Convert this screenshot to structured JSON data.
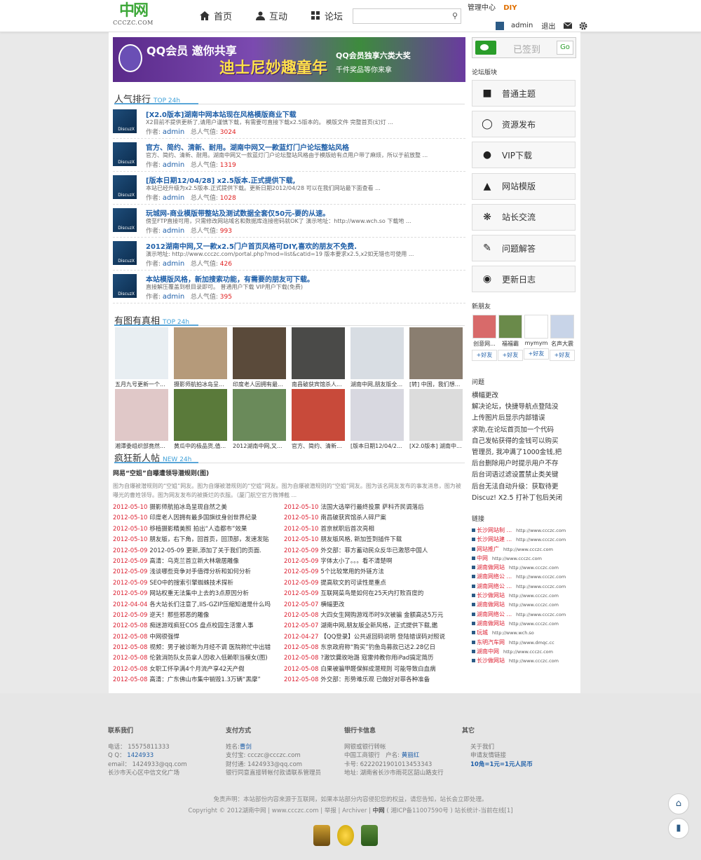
{
  "header": {
    "logo_mark": "中网",
    "logo_domain": "CCCZC.COM",
    "nav": [
      {
        "icon": "home-icon",
        "label": "首页"
      },
      {
        "icon": "user-icon",
        "label": "互动"
      },
      {
        "icon": "grid-icon",
        "label": "论坛"
      }
    ],
    "search_placeholder": "",
    "admin_center": "管理中心",
    "diy": "DIY",
    "username": "admin",
    "logout": "退出"
  },
  "banner": {
    "line1": "QQ会员 邀你共享",
    "line2": "迪士尼妙趣童年",
    "line3": "QQ会员独享六类大奖",
    "line4": "千件奖品等你来拿"
  },
  "popular": {
    "title": "人气排行",
    "tag": "TOP 24h",
    "author_label": "作者:",
    "pop_label": "总人气值:",
    "items": [
      {
        "title": "[X2.0版本]湖南中网本站现在风格模版商业下载",
        "desc": "X2目前不提供更新了,请用户谨慎下载，有需要可直接下载x2.5版本的。 模版文件 完整首页(幻灯 ...",
        "author": "admin",
        "count": "3024"
      },
      {
        "title": "官方、简约、清新、耐用。湖南中网又一款蓝灯门户论坛整站风格",
        "desc": "官方、简约、清新、耐用。湖南中网又一款蓝灯门户论坛整站风格由于模版给有点用户带了麻烦，所以于前放整 ...",
        "author": "admin",
        "count": "1319"
      },
      {
        "title": "[版本日期12/04/28]    x2.5版本.正式提供下载,",
        "desc": "本站已经升级为x2.5版本.正式提供下载。更新日期2012/04/28 可以在我们网站最下面查看 ...",
        "author": "admin",
        "count": "1028"
      },
      {
        "title": "玩城网-商业模版带整站及测试数据全套仅50元-要的从速。",
        "desc": "傍至FTP直接可用，只需修改网站域名和数据库连接密码就OK了 演示地址：http://www.wch.so 下载地 ...",
        "author": "admin",
        "count": "993"
      },
      {
        "title": "2012湖南中网,又一款x2.5门户首页风格可DIY,喜欢的朋友不免费.",
        "desc": "演示地址: http://www.ccczc.com/portal.php?mod=list&catid=19 版本要求x2.5,x2如无错也可使用 ...",
        "author": "admin",
        "count": "426"
      },
      {
        "title": "本站模版风格，新加搜索功能，有需要的朋友可下载。",
        "desc": "直接解压覆盖到根目录即可。 普通用户下载 VIP用户下载(免费)",
        "author": "admin",
        "count": "395"
      }
    ]
  },
  "gallery": {
    "title": "有图有真相",
    "tag": "TOP 24h",
    "row1": [
      {
        "caption": "五月九号更新一个...",
        "color": "#e8eef2"
      },
      {
        "caption": "摄影师航拍冰岛呈...",
        "color": "#b59a7a"
      },
      {
        "caption": "印度老人因拥有最...",
        "color": "#5a4a3a"
      },
      {
        "caption": "南昌破获宾馆杀人...",
        "color": "#4a4a48"
      },
      {
        "caption": "湖南中网,朋友版全...",
        "color": "#d8dde3"
      },
      {
        "caption": "[转] 中国，我们想...",
        "color": "#8a7e70"
      }
    ],
    "row2": [
      {
        "caption": "湘潭委组织部竟然...",
        "color": "#e0c8c8"
      },
      {
        "caption": "黄瓜中的极品货,值...",
        "color": "#5a7a3a"
      },
      {
        "caption": "2012湖南中网,又...",
        "color": "#6a8a5a"
      },
      {
        "caption": "官方、简约、清新...",
        "color": "#c84a3a"
      },
      {
        "caption": "[版本日期12/04/2...",
        "color": "#d8d8e0"
      },
      {
        "caption": "[X2.0版本] 湖南中...",
        "color": "#dcdcdc"
      }
    ]
  },
  "newposts": {
    "title": "疯狂新人帖",
    "tag": "NEW 24h",
    "headline": "网易“空姐”自曝遭领导潜规则(图)",
    "summary": "图为自爆被潜规则的“空姐”网友。图为自爆被潜规则的“空姐”网友。图为自爆被潜规则的“空姐”网友。图为该名网友发布的事发消息，图为被曝光的曹姓领导。图为网友发布的被撕烂的衣服。（厦门航空官方微博截 ...",
    "left": [
      {
        "date": "2012-05-10",
        "text": "摄影师航拍冰岛呈现自然之美"
      },
      {
        "date": "2012-05-10",
        "text": "印度老人因拥有最多国旗纹身创世界纪录"
      },
      {
        "date": "2012-05-10",
        "text": "移植摄影精美照 拍出“人造都市”效果"
      },
      {
        "date": "2012-05-10",
        "text": "朋友版，右下角，回首页，回顶部，发速发贴"
      },
      {
        "date": "2012-05-09",
        "text": "2012-05-09 更新,添加了关于我们的页面."
      },
      {
        "date": "2012-05-09",
        "text": "高清：乌克兰首立新大林墩居雕像"
      },
      {
        "date": "2012-05-09",
        "text": "浅谈哪些竞争对手值得分析和如何分析"
      },
      {
        "date": "2012-05-09",
        "text": "SEO中的搜索引擎蜘蛛技术探析"
      },
      {
        "date": "2012-05-09",
        "text": "网站权重无法集中上去的3点原因分析"
      },
      {
        "date": "2012-04-04",
        "text": "各大站长们注意了,IIS-GZIP压缩知道是什么吗"
      },
      {
        "date": "2012-05-09",
        "text": "逆天！那些邪恶的雕像"
      },
      {
        "date": "2012-05-08",
        "text": "痴迷游戏疯狂COS 盘点校园生活雷人事"
      },
      {
        "date": "2012-05-08",
        "text": "中网很强悍"
      },
      {
        "date": "2012-05-08",
        "text": "视频：男子被诊断为月经不调 医院称忙中出错"
      },
      {
        "date": "2012-05-08",
        "text": "伦敦消防队女员拿人因收入低赖职当模女(图)"
      },
      {
        "date": "2012-05-08",
        "text": "女职工怀孕满4个月流产享42天产假"
      },
      {
        "date": "2012-05-08",
        "text": "高清：广东佛山市集中销毁1.3万辆“黑摩”"
      }
    ],
    "right": [
      {
        "date": "2012-05-10",
        "text": "法国大选举行最终投票 萨科齐民调落后"
      },
      {
        "date": "2012-05-10",
        "text": "南昌破获宾馆杀人碎尸案"
      },
      {
        "date": "2012-05-10",
        "text": "首京就职后首次亮相"
      },
      {
        "date": "2012-05-10",
        "text": "朋友版风格, 新加签到插件下载"
      },
      {
        "date": "2012-05-09",
        "text": "外交部：菲方蓄动民众反华已激怒中国人"
      },
      {
        "date": "2012-05-09",
        "text": "字体太小了。。。看不清楚啊"
      },
      {
        "date": "2012-05-09",
        "text": "5个比较常用的外链方法"
      },
      {
        "date": "2012-05-09",
        "text": "提高软文的可读性是重点"
      },
      {
        "date": "2012-05-09",
        "text": "互联网菜鸟是如何在25天内打败百度的"
      },
      {
        "date": "2012-05-07",
        "text": "横幅更改"
      },
      {
        "date": "2012-05-08",
        "text": "大四女生网购游戏币时9次被骗 金额高达5万元"
      },
      {
        "date": "2012-05-07",
        "text": "湖南中网,朋友版全新风格，正式提供下载,鑑"
      },
      {
        "date": "2012-04-27",
        "text": "【QQ登录】公共返回码说明 登陆错误码对照说"
      },
      {
        "date": "2012-05-08",
        "text": "东京政府称“购买”钓鱼岛募款已达2.28亿日"
      },
      {
        "date": "2012-05-08",
        "text": "?澈饮爨玫咍潞 寇雷帅教你用iPad搞定简历"
      },
      {
        "date": "2012-05-08",
        "text": "白果被骗甲醛保鲜成潜规则 可能导致白血病"
      },
      {
        "date": "2012-05-08",
        "text": "外交部：形势难乐观 已做好对菲各种准备"
      }
    ]
  },
  "sidebar": {
    "sign_label": "已签到",
    "sign_go": "Go",
    "forum_title": "论坛版块",
    "buttons": [
      {
        "icon": "chat-icon",
        "label": "普通主题"
      },
      {
        "icon": "eye-icon",
        "label": "资源发布"
      },
      {
        "icon": "person-icon",
        "label": "VIP下载"
      },
      {
        "icon": "template-icon",
        "label": "网站模版"
      },
      {
        "icon": "gear-icon",
        "label": "站长交流"
      },
      {
        "icon": "edit-icon",
        "label": "问题解答"
      },
      {
        "icon": "log-icon",
        "label": "更新日志"
      }
    ],
    "friends_title": "新朋友",
    "friends": [
      {
        "name": "创意网...",
        "add": "+好友",
        "color": "#d86a6a"
      },
      {
        "name": "福福霸",
        "add": "+好友",
        "color": "#6a8a4a"
      },
      {
        "name": "mymym",
        "add": "+好友",
        "color": "#ffffff"
      },
      {
        "name": "名声大震",
        "add": "+好友",
        "color": "#c8d4e8"
      }
    ],
    "questions_title": "问题",
    "questions": [
      "横幅更改",
      "解决论坛，快捷导航点登陆没",
      "上传图片后显示内部错误",
      "求助,在论坛首页加一个代码",
      "自己发帖获得的金钱可以购买",
      "管理员, 我冲满了1000金钱,把",
      "后台删除用户时提示用户不存",
      "后台词语过滤设置禁止类关键",
      "后台无法自动升级：获取待更",
      "Discuz! X2.5 打补丁包后关闭"
    ],
    "links_title": "链接",
    "links": [
      {
        "name": "长沙网站制 ...",
        "url": "http://www.ccczc.com"
      },
      {
        "name": "长沙网站建 ...",
        "url": "http://www.ccczc.com"
      },
      {
        "name": "网站推广",
        "url": "http://www.ccczc.com"
      },
      {
        "name": "中网",
        "url": "http://www.ccczc.com"
      },
      {
        "name": "湖南做网站",
        "url": "http://www.ccczc.com"
      },
      {
        "name": "湖南网络公 ...",
        "url": "http://www.ccczc.com"
      },
      {
        "name": "湖南网络公 ...",
        "url": "http://www.ccczc.com"
      },
      {
        "name": "长沙做网站",
        "url": "http://www.ccczc.com"
      },
      {
        "name": "湖南做网站",
        "url": "http://www.ccczc.com"
      },
      {
        "name": "湖南网络公 ...",
        "url": "http://www.ccczc.com"
      },
      {
        "name": "湖南做网站",
        "url": "http://www.ccczc.com"
      },
      {
        "name": "玩城",
        "url": "http://www.wch.so"
      },
      {
        "name": "东明汽车网",
        "url": "http://www.dmqc.cc"
      },
      {
        "name": "湖南中网",
        "url": "http://www.ccczc.com"
      },
      {
        "name": "长沙做网站",
        "url": "http://www.ccczc.com"
      }
    ]
  },
  "footer": {
    "contact": {
      "title": "联系我们",
      "phone": "电话： 15575811333",
      "qq_label": "Q Q：",
      "qq": "1424933",
      "email": "email： 1424933@qq.com",
      "addr": "长沙市天心区中信文化广场"
    },
    "pay": {
      "title": "支付方式",
      "name_label": "姓名:",
      "name": "曹剑",
      "alipay": "支付宝: ccczc@ccczc.com",
      "tenpay": "财付通: 1424933@qq.com",
      "note": "银行同意直接转帐付款请联系管理员"
    },
    "bank": {
      "title": "银行卡信息",
      "l1": "网银或银行转帐",
      "l2a": "中国工商银行",
      "l2b": "户名:",
      "l2c": "黄丽红",
      "l3": "卡号: 6222021901013453343",
      "l4": "地址: 湖南省长沙市雨花区韶山路支行"
    },
    "other": {
      "title": "其它",
      "l1": "关于我们",
      "l2": "申请友情链接",
      "l3": "10角=1元=1元人民币"
    },
    "disclaimer": "免责声明：本站部份内容来源于互联网，如果本站部分内容侵犯您的权益，请您告知，站长会立即处理。",
    "copyright": "Copyright © 2012湖南中网 | www.ccczc.com | 举报 | Archiver |",
    "icp_bold": "中网",
    "icp": "( 湘ICP备11007590号 ) 站长统计-当前在线[1]"
  }
}
